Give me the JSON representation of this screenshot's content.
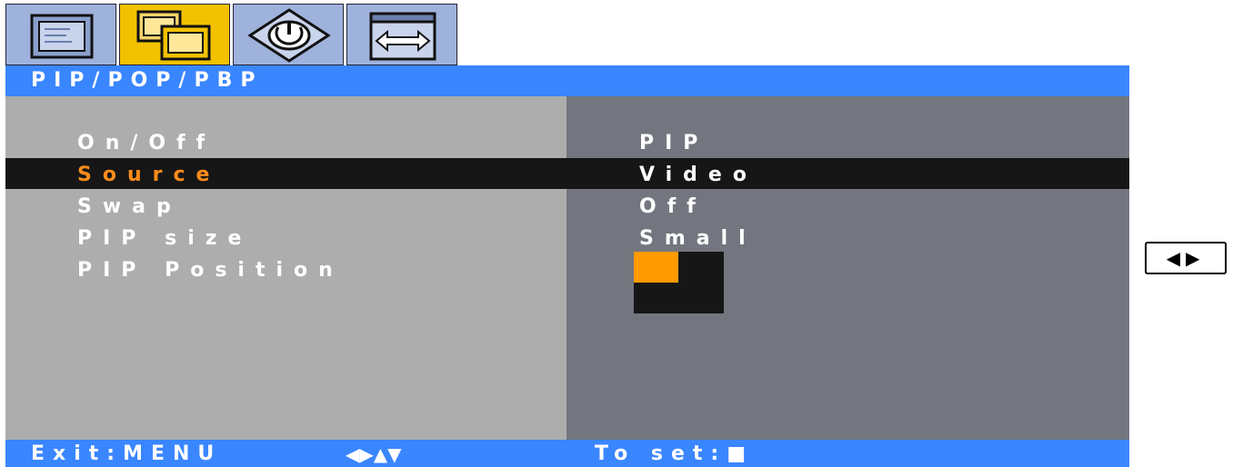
{
  "tabs": [
    {
      "icon": "monitor-icon",
      "active": false
    },
    {
      "icon": "multi-window-icon",
      "active": true
    },
    {
      "icon": "settings-icon",
      "active": false
    },
    {
      "icon": "window-resize-icon",
      "active": false
    }
  ],
  "menu": {
    "title": "PIP/POP/PBP",
    "items": [
      {
        "label": "On/Off",
        "value": "PIP"
      },
      {
        "label": "Source",
        "value": "Video",
        "selected": true
      },
      {
        "label": "Swap",
        "value": "Off"
      },
      {
        "label": "PIP size",
        "value": "Small"
      },
      {
        "label": "PIP Position",
        "value": "",
        "position": "top-left"
      }
    ]
  },
  "footer": {
    "exit_hint": "Exit:MENU",
    "nav_glyphs": "◀▶▲▼",
    "set_hint": "To set:■"
  },
  "side_key": {
    "glyphs": "◀▶"
  },
  "colors": {
    "title_bar": "#3a86ff",
    "active_tab": "#f2c200",
    "inactive_tab": "#9fb2dc",
    "selection_bar": "#161616",
    "selected_label": "#ff8c1a",
    "pip_position_marker": "#ff9a00"
  }
}
